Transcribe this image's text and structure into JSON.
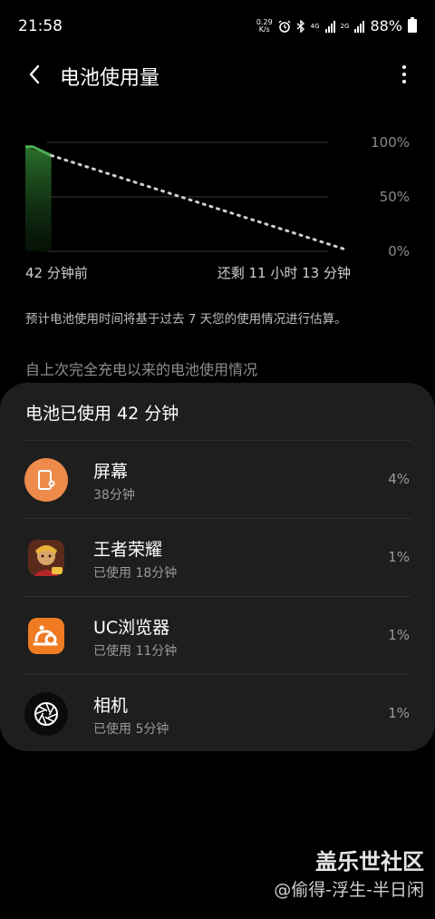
{
  "status_bar": {
    "time": "21:58",
    "net_speed_value": "0.29",
    "net_speed_unit": "K/s",
    "network_1": "4G",
    "network_2": "2G",
    "battery_percent": "88%",
    "icons": [
      "alarm-icon",
      "bluetooth-icon",
      "signal-icon",
      "battery-icon"
    ]
  },
  "header": {
    "title": "电池使用量",
    "back_icon": "chevron-left-icon",
    "more_icon": "more-vertical-icon"
  },
  "chart_data": {
    "type": "line",
    "y_tick_labels": [
      "100%",
      "50%",
      "0%"
    ],
    "ylim": [
      0,
      100
    ],
    "x_start_label": "42 分钟前",
    "x_end_label": "还剩 11 小时 13 分钟",
    "series": [
      {
        "values": [
          {
            "x": 0,
            "y": 96
          },
          {
            "x": 42,
            "y": 88
          }
        ],
        "style": "solid",
        "color": "#4caf50"
      },
      {
        "values": [
          {
            "x": 42,
            "y": 88
          },
          {
            "x": 715,
            "y": 2
          }
        ],
        "style": "dotted",
        "color": "#cfcfcf"
      }
    ],
    "grid": true
  },
  "estimate_note": "预计电池使用时间将基于过去 7 天您的使用情况进行估算。",
  "section_title": "自上次完全充电以来的电池使用情况",
  "usage": {
    "summary": "电池已使用 42 分钟",
    "apps": [
      {
        "name": "屏幕",
        "sub": "38分钟",
        "percent": "4%",
        "icon": "screen-icon",
        "color": "#ee8a4a"
      },
      {
        "name": "王者荣耀",
        "sub": "已使用 18分钟",
        "percent": "1%",
        "icon": "game-icon"
      },
      {
        "name": "UC浏览器",
        "sub": "已使用 11分钟",
        "percent": "1%",
        "icon": "uc-browser-icon",
        "color": "#f07b23"
      },
      {
        "name": "相机",
        "sub": "已使用 5分钟",
        "percent": "1%",
        "icon": "camera-icon"
      }
    ]
  },
  "watermark": {
    "logo": "盖乐世社区",
    "user": "@偷得-浮生-半日闲"
  }
}
